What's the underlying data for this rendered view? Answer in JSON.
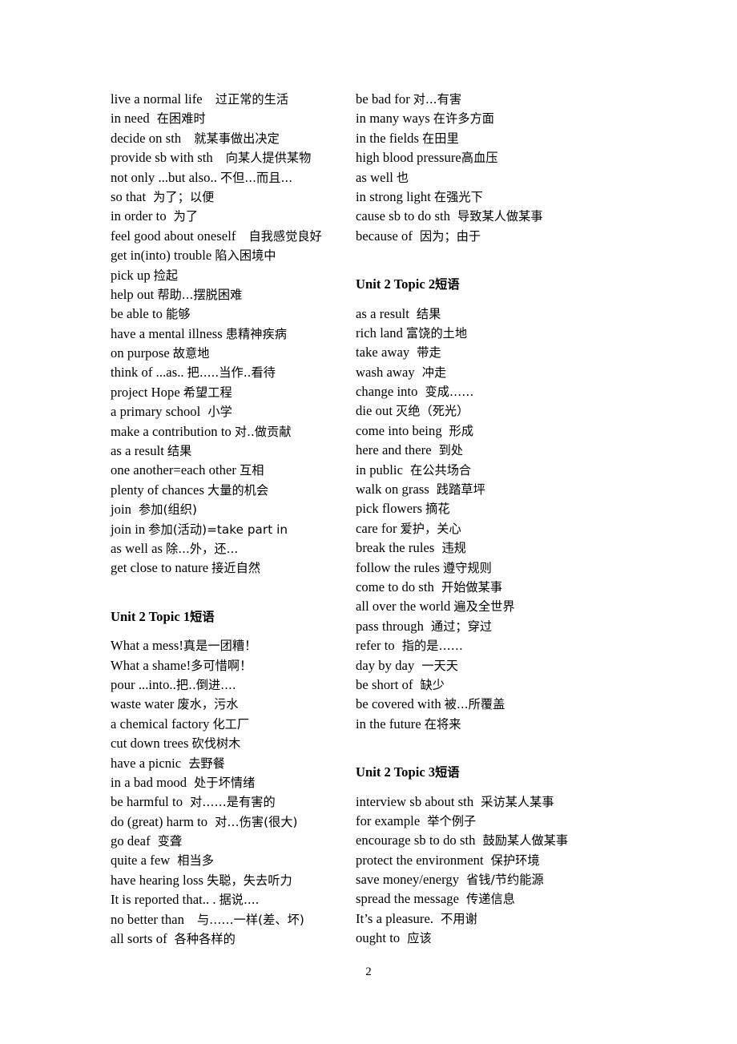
{
  "page": {
    "number": "2"
  },
  "left_column": {
    "blocks": [
      {
        "type": "list",
        "entries": [
          {
            "en": "live a normal life",
            "gap": "l",
            "zh": "过正常的生活"
          },
          {
            "en": "in need",
            "gap": "m",
            "zh": "在困难时"
          },
          {
            "en": "decide on sth",
            "gap": "l",
            "zh": "就某事做出决定"
          },
          {
            "en": "provide sb with sth",
            "gap": "l",
            "zh": "向某人提供某物"
          },
          {
            "en": "not only ...but also..",
            "gap": "s",
            "zh": "不但...而且..."
          },
          {
            "en": "so that",
            "gap": "m",
            "zh": "为了；以便"
          },
          {
            "en": "in order to",
            "gap": "m",
            "zh": "为了"
          },
          {
            "en": "feel good about oneself",
            "gap": "l",
            "zh": "自我感觉良好"
          },
          {
            "en": "get in(into) trouble",
            "gap": "s",
            "zh": "陷入困境中"
          },
          {
            "en": "pick up",
            "gap": "s",
            "zh": "捡起"
          },
          {
            "en": "help out",
            "gap": "s",
            "zh": "帮助...摆脱困难"
          },
          {
            "en": "be able to",
            "gap": "s",
            "zh": "能够"
          },
          {
            "en": "have a mental illness",
            "gap": "s",
            "zh": "患精神疾病"
          },
          {
            "en": "on purpose",
            "gap": "s",
            "zh": "故意地"
          },
          {
            "en": "think of ...as..",
            "gap": "s",
            "zh": "把.....当作..看待"
          },
          {
            "en": "project Hope",
            "gap": "s",
            "zh": "希望工程"
          },
          {
            "en": "a primary school",
            "gap": "m",
            "zh": "小学"
          },
          {
            "en": "make a contribution to",
            "gap": "s",
            "zh": "对..做贡献"
          },
          {
            "en": "as a result",
            "gap": "s",
            "zh": "结果"
          },
          {
            "en": "one another=each other",
            "gap": "s",
            "zh": "互相"
          },
          {
            "en": "plenty of chances",
            "gap": "s",
            "zh": "大量的机会"
          },
          {
            "en": "join",
            "gap": "m",
            "zh": "参加(组织)"
          },
          {
            "en": "join in",
            "gap": "s",
            "zh": "参加(活动)=take part in"
          },
          {
            "en": "as well as",
            "gap": "s",
            "zh": "除...外，还..."
          },
          {
            "en": "get close to nature",
            "gap": "s",
            "zh": "接近自然"
          }
        ]
      },
      {
        "type": "heading",
        "en": "Unit 2 Topic 1",
        "gap": "s",
        "zh": "短语"
      },
      {
        "type": "list",
        "entries": [
          {
            "en": "What a mess!",
            "gap": "none",
            "zh": "真是一团糟！"
          },
          {
            "en": "What a shame!",
            "gap": "none",
            "zh": "多可惜啊！"
          },
          {
            "en": "pour ...into..",
            "gap": "none",
            "zh": "把..倒进...."
          },
          {
            "en": "waste water",
            "gap": "s",
            "zh": "废水，污水"
          },
          {
            "en": "a chemical factory",
            "gap": "s",
            "zh": "化工厂"
          },
          {
            "en": "cut down trees",
            "gap": "s",
            "zh": "砍伐树木"
          },
          {
            "en": "have a picnic",
            "gap": "m",
            "zh": "去野餐"
          },
          {
            "en": "in a bad mood",
            "gap": "m",
            "zh": "处于坏情绪"
          },
          {
            "en": "be harmful to",
            "gap": "m",
            "zh": "对……是有害的"
          },
          {
            "en": "do (great) harm to",
            "gap": "m",
            "zh": "对…伤害(很大)"
          },
          {
            "en": "go deaf",
            "gap": "m",
            "zh": "变聋"
          },
          {
            "en": "quite a few",
            "gap": "m",
            "zh": "相当多"
          },
          {
            "en": "have hearing loss",
            "gap": "s",
            "zh": "失聪，失去听力"
          },
          {
            "en": "It is reported that.. .",
            "gap": "s",
            "zh": "据说...."
          },
          {
            "en": "no better than",
            "gap": "l",
            "zh": "与……一样(差、坏)"
          },
          {
            "en": "all sorts of",
            "gap": "m",
            "zh": "各种各样的"
          }
        ]
      }
    ]
  },
  "right_column": {
    "blocks": [
      {
        "type": "list",
        "entries": [
          {
            "en": "be bad for",
            "gap": "s",
            "zh": "对...有害"
          },
          {
            "en": "in many ways",
            "gap": "s",
            "zh": "在许多方面"
          },
          {
            "en": "in the fields",
            "gap": "s",
            "zh": "在田里"
          },
          {
            "en": "high blood pressure",
            "gap": "none",
            "zh": "高血压"
          },
          {
            "en": "as well",
            "gap": "s",
            "zh": "也"
          },
          {
            "en": "in strong light",
            "gap": "s",
            "zh": "在强光下"
          },
          {
            "en": "cause sb to do sth",
            "gap": "m",
            "zh": "导致某人做某事"
          },
          {
            "en": "because of",
            "gap": "m",
            "zh": "因为；由于"
          }
        ]
      },
      {
        "type": "heading",
        "en": "Unit 2 Topic 2",
        "gap": "s",
        "zh": "短语"
      },
      {
        "type": "list",
        "entries": [
          {
            "en": "as a result",
            "gap": "m",
            "zh": "结果"
          },
          {
            "en": "rich land",
            "gap": "s",
            "zh": "富饶的土地"
          },
          {
            "en": "take away",
            "gap": "m",
            "zh": "带走"
          },
          {
            "en": "wash away",
            "gap": "m",
            "zh": "冲走"
          },
          {
            "en": "change into",
            "gap": "m",
            "zh": "变成……"
          },
          {
            "en": "die out",
            "gap": "s",
            "zh": "灭绝（死光）"
          },
          {
            "en": "come into being",
            "gap": "m",
            "zh": "形成"
          },
          {
            "en": "here and there",
            "gap": "m",
            "zh": "到处"
          },
          {
            "en": "in public",
            "gap": "m",
            "zh": "在公共场合"
          },
          {
            "en": "walk on grass",
            "gap": "m",
            "zh": "践踏草坪"
          },
          {
            "en": "pick flowers",
            "gap": "s",
            "zh": "摘花"
          },
          {
            "en": "care for",
            "gap": "s",
            "zh": "爱护，关心"
          },
          {
            "en": "break the rules",
            "gap": "m",
            "zh": "违规"
          },
          {
            "en": "follow the rules",
            "gap": "s",
            "zh": "遵守规则"
          },
          {
            "en": "come to do sth",
            "gap": "m",
            "zh": "开始做某事"
          },
          {
            "en": "all over the world",
            "gap": "s",
            "zh": "遍及全世界"
          },
          {
            "en": "pass through",
            "gap": "m",
            "zh": "通过；穿过"
          },
          {
            "en": "refer to",
            "gap": "m",
            "zh": "指的是……"
          },
          {
            "en": "day by day",
            "gap": "m",
            "zh": "一天天"
          },
          {
            "en": "be short of",
            "gap": "m",
            "zh": "缺少"
          },
          {
            "en": "be covered with",
            "gap": "s",
            "zh": "被...所覆盖"
          },
          {
            "en": "in the future",
            "gap": "s",
            "zh": "在将来"
          }
        ]
      },
      {
        "type": "heading",
        "en": "Unit 2 Topic 3",
        "gap": "s",
        "zh": "短语"
      },
      {
        "type": "list",
        "entries": [
          {
            "en": "interview sb about sth",
            "gap": "m",
            "zh": "采访某人某事"
          },
          {
            "en": "for example",
            "gap": "m",
            "zh": "举个例子"
          },
          {
            "en": "encourage sb to do sth",
            "gap": "m",
            "zh": "鼓励某人做某事"
          },
          {
            "en": "protect the environment",
            "gap": "m",
            "zh": "保护环境"
          },
          {
            "en": "save money/energy",
            "gap": "m",
            "zh": "省钱/节约能源"
          },
          {
            "en": "spread the message",
            "gap": "m",
            "zh": "传递信息"
          },
          {
            "en": "It’s a pleasure.",
            "gap": "m",
            "zh": "不用谢"
          },
          {
            "en": "ought to",
            "gap": "m",
            "zh": "应该"
          }
        ]
      }
    ]
  }
}
